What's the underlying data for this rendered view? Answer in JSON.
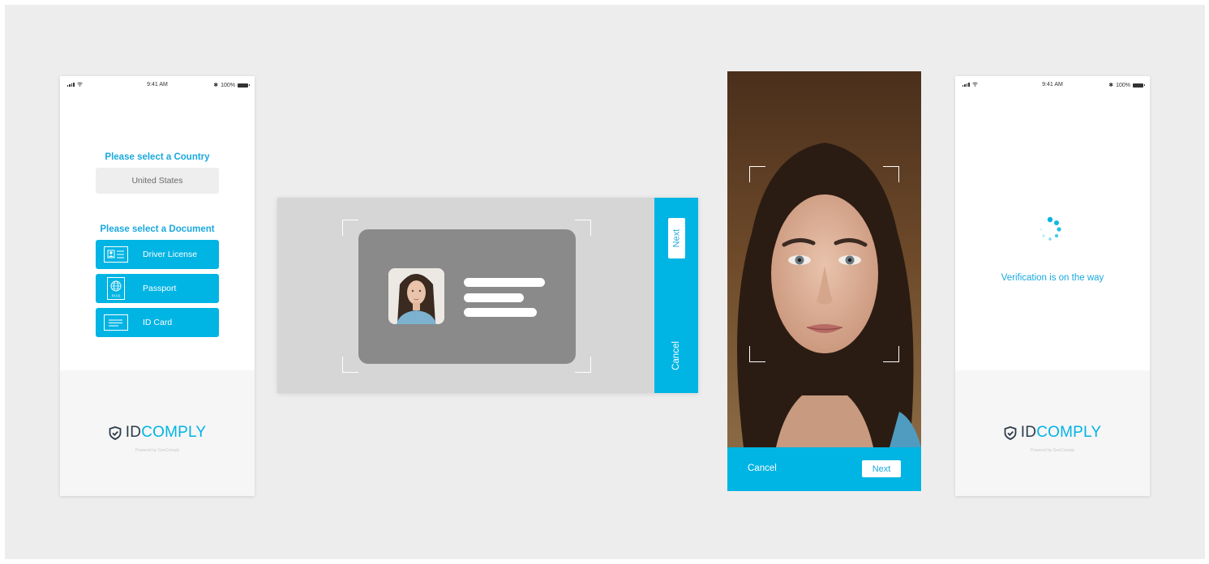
{
  "status_bar": {
    "time": "9:41 AM",
    "battery": "100%"
  },
  "screen1": {
    "country_heading_prefix": "Please select a ",
    "country_heading_strong": "Country",
    "country_value": "United States",
    "document_heading_prefix": "Please select a ",
    "document_heading_strong": "Document",
    "documents": [
      {
        "label": "Driver License",
        "icon": "id-card-photo-icon"
      },
      {
        "label": "Passport",
        "icon": "passport-globe-icon",
        "icon_text": "PASS"
      },
      {
        "label": "ID Card",
        "icon": "id-card-lines-icon"
      }
    ]
  },
  "scanner": {
    "next_label": "Next",
    "cancel_label": "Cancel"
  },
  "selfie": {
    "cancel_label": "Cancel",
    "next_label": "Next"
  },
  "screen4": {
    "verification_text": "Verification is on the way"
  },
  "brand": {
    "id": "ID",
    "comply": "COMPLY",
    "powered": "Powered by GeoComply",
    "icon": "shield-check-icon"
  },
  "colors": {
    "accent": "#00b4e4",
    "background": "#ededed",
    "card_gray": "#8a8a8a",
    "footer": "#f6f6f6"
  }
}
